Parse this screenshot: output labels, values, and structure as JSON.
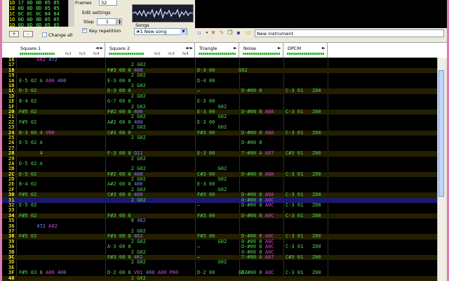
{
  "frames": {
    "rows": [
      {
        "idx": "1D",
        "cells": "17 0D 0D 05 05",
        "highlight": false
      },
      {
        "idx": "1E",
        "cells": "0D 0D 0D 05 05",
        "highlight": true
      },
      {
        "idx": "1C",
        "cells": "0C 0C 0C 04 04",
        "highlight": false
      },
      {
        "idx": "1D",
        "cells": "0D 0D 0D 05 05",
        "highlight": false
      },
      {
        "idx": "1D",
        "cells": "0D 0D 0D 05 05",
        "highlight": false
      }
    ],
    "frames_label": "Frames",
    "frames_value": "32",
    "add_btn": "+",
    "remove_btn": "-",
    "change_all": "Change all"
  },
  "edit": {
    "title": "Edit settings",
    "step_label": "Step",
    "step_value": "1",
    "key_repetition": "Key repetition"
  },
  "songs": {
    "label": "Songs",
    "selected": "#1 New song"
  },
  "instrument": {
    "name": "New instrument"
  },
  "channels": [
    {
      "name": "Square 1",
      "fx": [
        "fx2",
        "fx3",
        "fx4"
      ]
    },
    {
      "name": "Square 2",
      "fx": [
        "fx2",
        "fx3",
        "fx4"
      ]
    },
    {
      "name": "Triangle",
      "fx": []
    },
    {
      "name": "Noise",
      "fx": []
    },
    {
      "name": "DPCM",
      "fx": []
    }
  ],
  "pattern_rows": [
    {
      "n": "16",
      "c": [
        "      A02 472",
        "",
        "",
        "",
        ""
      ],
      "cls": [
        "v",
        "",
        "",
        "",
        ""
      ]
    },
    {
      "n": "17",
      "c": [
        "",
        "        2 G02",
        "",
        "",
        ""
      ]
    },
    {
      "n": "18",
      "c": [
        "",
        "F#3 00 8 400",
        "D-3 00        G02",
        "",
        ""
      ]
    },
    {
      "n": "19",
      "c": [
        "",
        "        2 G02",
        "",
        "",
        ""
      ]
    },
    {
      "n": "1A",
      "c": [
        "E-5 02 A A00 400",
        "E-3 00 8",
        "D-4 00",
        "",
        ""
      ]
    },
    {
      "n": "1B",
      "c": [
        "",
        "        2 G02",
        "",
        "",
        ""
      ]
    },
    {
      "n": "1C",
      "c": [
        "D-5 02",
        "D-3 00 8",
        "—",
        "D-#00 8",
        "C-3 01   Z00"
      ]
    },
    {
      "n": "1D",
      "c": [
        "",
        "        2 G02",
        "",
        "",
        ""
      ]
    },
    {
      "n": "1E",
      "c": [
        "B-4 02",
        "G-7 00 8",
        "E-3 00",
        "",
        ""
      ]
    },
    {
      "n": "1F",
      "c": [
        "",
        "        2 G02",
        "       G02",
        "",
        ""
      ]
    },
    {
      "n": "20",
      "c": [
        "F#5 02",
        "F#2 00 8 400",
        "E-3 00",
        "D-#00 8 A0A",
        "C-3 01   Z00"
      ]
    },
    {
      "n": "21",
      "c": [
        "",
        "        2 G02",
        "       G02",
        "",
        ""
      ]
    },
    {
      "n": "22",
      "c": [
        "F#5 02",
        "A#2 00 8 400",
        "E-3 00",
        "",
        ""
      ]
    },
    {
      "n": "23",
      "c": [
        "",
        "        2 G02",
        "       G02",
        "",
        ""
      ]
    },
    {
      "n": "24",
      "c": [
        "B-3 00 4 V00",
        "C#3 00 8",
        "F#3 00",
        "D-#00 8 A0A",
        "C-3 01   Z00"
      ]
    },
    {
      "n": "25",
      "c": [
        "",
        "        2 G02",
        "",
        "",
        ""
      ]
    },
    {
      "n": "26",
      "c": [
        "E-5 02 A",
        "",
        "",
        "D-#00 8",
        ""
      ]
    },
    {
      "n": "27",
      "c": [
        "",
        "",
        "",
        "",
        ""
      ]
    },
    {
      "n": "28",
      "c": [
        "       4",
        "F-3 00 8 Q11",
        "E-3 00",
        "7-#00 A A07",
        "C#3 01   Z00"
      ]
    },
    {
      "n": "29",
      "c": [
        "",
        "        2 G02",
        "",
        "",
        ""
      ]
    },
    {
      "n": "2A",
      "c": [
        "D-5 02 A",
        "",
        "",
        "",
        ""
      ]
    },
    {
      "n": "2B",
      "c": [
        "",
        "        2 G02",
        "       G02",
        "",
        ""
      ]
    },
    {
      "n": "2C",
      "c": [
        "E-5 02",
        "F#2 00 8 400",
        "C#3 00",
        "D-#00 8 A0A",
        "C-3 01   Z00"
      ]
    },
    {
      "n": "2D",
      "c": [
        "",
        "        2 G02",
        "       G02",
        "",
        ""
      ]
    },
    {
      "n": "2E",
      "c": [
        "B-4 02",
        "A#2 00 8 400",
        "E-3 00",
        "",
        ""
      ]
    },
    {
      "n": "2F",
      "c": [
        "",
        "        2 G02",
        "       G02",
        "",
        ""
      ]
    },
    {
      "n": "30",
      "c": [
        "F#5 02",
        "C#3 00 8 400",
        "F#3 00",
        "D-#00 8 A0A",
        "C-3 01   Z00"
      ]
    },
    {
      "n": "31",
      "c": [
        "",
        "        2 G02",
        "",
        "0-#00 8 A0C",
        ""
      ]
    },
    {
      "n": "32",
      "c": [
        "E-5 02",
        "",
        "—",
        "D-#00 8 A0C",
        "C-3 01   Z00"
      ]
    },
    {
      "n": "33",
      "c": [
        "",
        "",
        "",
        "",
        ""
      ]
    },
    {
      "n": "34",
      "c": [
        "F#5 02",
        "F#3 00 8",
        "F#3 00",
        "D-#00 8 A0C",
        "C-3 01   Z00"
      ]
    },
    {
      "n": "35",
      "c": [
        "",
        "        8 462",
        "",
        "",
        ""
      ]
    },
    {
      "n": "36",
      "c": [
        "      472 A02",
        "",
        "",
        "",
        ""
      ]
    },
    {
      "n": "37",
      "c": [
        "",
        "        2 G02",
        "",
        "",
        ""
      ]
    },
    {
      "n": "38",
      "c": [
        "F#5 02",
        "F#3 00 8 462",
        "F#3 00",
        "D-#00 8 A0C",
        "C-3 01   Z00"
      ]
    },
    {
      "n": "39",
      "c": [
        "",
        "        2 G02",
        "       G02",
        "0-#00 8 A0C",
        ""
      ]
    },
    {
      "n": "3A",
      "c": [
        "",
        "A-3 00 8",
        "—",
        "D-#00 8 A0C",
        "C-3 01   Z00"
      ]
    },
    {
      "n": "3B",
      "c": [
        "",
        "        2 G02",
        "",
        "0-#00 8 A0C",
        ""
      ]
    },
    {
      "n": "3C",
      "c": [
        "",
        "F#3 00 8 462",
        "—",
        "7-#00 A A07",
        "C#3 01   Z00"
      ]
    },
    {
      "n": "3D",
      "c": [
        "",
        "        2 G02",
        "       G02",
        "",
        ""
      ]
    },
    {
      "n": "3E",
      "c": [
        "",
        "",
        "",
        "",
        ""
      ]
    },
    {
      "n": "3F",
      "c": [
        "F#5 03 8 A00 400",
        "D-2 00 8 V01 400 A00 P80",
        "D-2 00        G02",
        "D-#00 8 A0C",
        "C-3 01   Z00"
      ]
    },
    {
      "n": "40",
      "c": [
        "",
        "        2 G02",
        "",
        "",
        ""
      ]
    }
  ],
  "colors": {
    "highlight_row": "#2a2a00",
    "cursor_row": "#1a1a6a",
    "note": "#4cd84c",
    "fx": "#8080ff",
    "vol": "#d848d8",
    "row_num": "#dcdc30"
  }
}
